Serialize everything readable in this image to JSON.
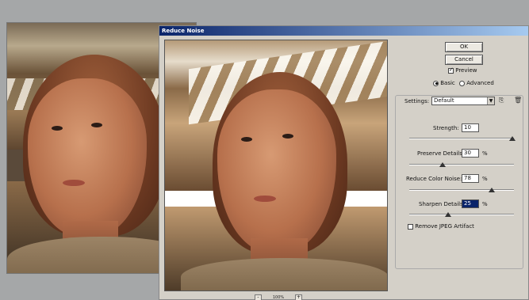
{
  "dialog": {
    "title": "Reduce Noise",
    "ok_label": "OK",
    "cancel_label": "Cancel",
    "preview_label": "Preview",
    "preview_checked": true,
    "mode_basic_label": "Basic",
    "mode_advanced_label": "Advanced",
    "mode_selected": "Basic",
    "zoom_level": "100%",
    "zoom_minus": "-",
    "zoom_plus": "+",
    "settings_label": "Settings:",
    "settings_value": "Default",
    "strength_label": "Strength:",
    "strength_value": "10",
    "strength_fraction": 0.99,
    "preserve_label": "Preserve Details:",
    "preserve_value": "30",
    "preserve_fraction": 0.3,
    "reduce_color_label": "Reduce Color Noise:",
    "reduce_color_value": "78",
    "reduce_color_fraction": 0.78,
    "sharpen_label": "Sharpen Details:",
    "sharpen_value": "25",
    "sharpen_fraction": 0.36,
    "percent": "%",
    "jpeg_label": "Remove JPEG Artifact",
    "jpeg_checked": false
  },
  "icons": {
    "save_preset": "save-icon",
    "delete_preset": "trash-icon",
    "dropdown": "chevron-down-icon"
  }
}
